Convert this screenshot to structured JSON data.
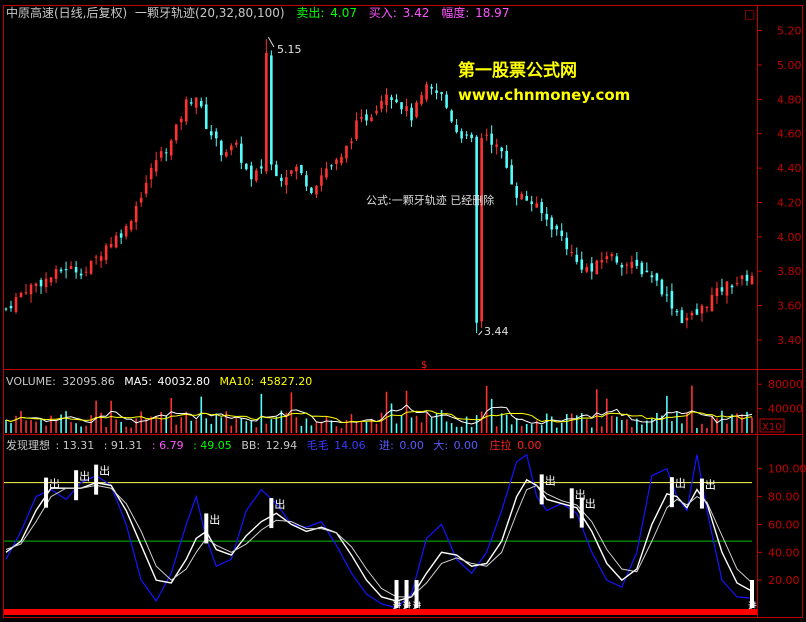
{
  "header": {
    "stock": "中原高速(日线,后复权)",
    "indicator": "一颗牙轨迹(20,32,80,100)",
    "sell_label": "卖出:",
    "sell_value": "4.07",
    "buy_label": "买入:",
    "buy_value": "3.42",
    "range_label": "幅度:",
    "range_value": "18.97"
  },
  "watermark": {
    "name": "第一股票公式网",
    "url": "www.chnmoney.com"
  },
  "annotations": {
    "high_label": "5.15",
    "low_label": "3.44",
    "formula_note": "公式:一颗牙轨迹 已经删除",
    "dollar_marker": "$",
    "corner_box": "□"
  },
  "volume_header": {
    "label": "VOLUME:",
    "volume": "32095.86",
    "ma5_label": "MA5:",
    "ma5": "40032.80",
    "ma10_label": "MA10:",
    "ma10": "45827.20",
    "multiplier": "X10"
  },
  "indicator_header": {
    "name": "发现理想",
    "v1": ": 13.31",
    "v2": ": 91.31",
    "v3": ": 6.79",
    "v4": ": 49.05",
    "bb_label": "BB:",
    "bb": "12.94",
    "fuzzy_label": "毛毛",
    "fuzzy": "14.06",
    "in_label": "进:",
    "in_value": "0.00",
    "big_label": "大:",
    "big_value": "0.00",
    "zhuang_label": "庄拉",
    "zhuang_value": "0.00"
  },
  "signal_labels": {
    "out": "出",
    "in": "进"
  },
  "colors": {
    "background": "#000000",
    "up_candle": "#ff3232",
    "down_candle": "#54fcfc",
    "axis": "#c00000",
    "header_sell": "#00ff00",
    "header_buy": "#ff54ff",
    "watermark": "#ffff00",
    "ma5": "#ffffff",
    "ma10": "#ffff00",
    "osc_fast": "#1414ff",
    "osc_mid": "#ffffff",
    "osc_slow": "#d0d0d0",
    "line_top": "#ffff54",
    "line_mid": "#00c000",
    "zhuang_bar": "#ff0000"
  },
  "chart_data": [
    {
      "type": "candlestick",
      "title": "中原高速(日线,后复权)",
      "y_ticks": [
        "5.20",
        "5.00",
        "4.80",
        "4.60",
        "4.40",
        "4.20",
        "4.00",
        "3.80",
        "3.60",
        "3.40"
      ],
      "ylim": [
        3.33,
        5.25
      ],
      "x_count": 150,
      "close_path": [
        [
          0,
          3.58
        ],
        [
          4,
          3.7
        ],
        [
          8,
          3.75
        ],
        [
          12,
          3.82
        ],
        [
          16,
          3.8
        ],
        [
          20,
          3.95
        ],
        [
          24,
          4.05
        ],
        [
          27,
          4.25
        ],
        [
          30,
          4.45
        ],
        [
          33,
          4.55
        ],
        [
          36,
          4.78
        ],
        [
          38,
          4.82
        ],
        [
          40,
          4.65
        ],
        [
          43,
          4.5
        ],
        [
          46,
          4.52
        ],
        [
          49,
          4.32
        ],
        [
          52,
          4.45
        ],
        [
          55,
          4.35
        ],
        [
          58,
          4.4
        ],
        [
          61,
          4.28
        ],
        [
          64,
          4.4
        ],
        [
          67,
          4.45
        ],
        [
          70,
          4.65
        ],
        [
          73,
          4.72
        ],
        [
          76,
          4.85
        ],
        [
          78,
          4.8
        ],
        [
          81,
          4.7
        ],
        [
          84,
          4.86
        ],
        [
          87,
          4.82
        ],
        [
          90,
          4.62
        ],
        [
          93,
          4.55
        ],
        [
          96,
          4.6
        ],
        [
          99,
          4.48
        ],
        [
          102,
          4.25
        ],
        [
          105,
          4.2
        ],
        [
          108,
          4.1
        ],
        [
          111,
          4.0
        ],
        [
          114,
          3.85
        ],
        [
          117,
          3.8
        ],
        [
          120,
          3.9
        ],
        [
          123,
          3.85
        ],
        [
          126,
          3.82
        ],
        [
          129,
          3.78
        ],
        [
          132,
          3.65
        ],
        [
          135,
          3.52
        ],
        [
          138,
          3.55
        ],
        [
          141,
          3.65
        ],
        [
          144,
          3.72
        ],
        [
          147,
          3.75
        ],
        [
          149,
          3.78
        ]
      ],
      "high": {
        "value": 5.15,
        "index": 52
      },
      "low": {
        "value": 3.44,
        "index": 94
      }
    },
    {
      "type": "bar",
      "title": "VOLUME",
      "y_ticks": [
        "80000",
        "40000"
      ],
      "ylim": [
        0,
        100000
      ],
      "series": [
        {
          "name": "VOLUME",
          "last": 32095.86
        },
        {
          "name": "MA5",
          "last": 40032.8
        },
        {
          "name": "MA10",
          "last": 45827.2
        }
      ]
    },
    {
      "type": "line",
      "title": "发现理想",
      "y_ticks": [
        "100.00",
        "80.00",
        "60.00",
        "40.00",
        "20.00"
      ],
      "ylim": [
        0,
        112
      ],
      "reference_lines": [
        90,
        48
      ],
      "series": [
        {
          "name": "fast",
          "points": [
            [
              0,
              35
            ],
            [
              3,
              55
            ],
            [
              6,
              80
            ],
            [
              9,
              85
            ],
            [
              12,
              78
            ],
            [
              15,
              90
            ],
            [
              18,
              95
            ],
            [
              21,
              88
            ],
            [
              24,
              60
            ],
            [
              27,
              20
            ],
            [
              30,
              5
            ],
            [
              33,
              25
            ],
            [
              36,
              60
            ],
            [
              38,
              80
            ],
            [
              40,
              50
            ],
            [
              42,
              30
            ],
            [
              45,
              35
            ],
            [
              48,
              70
            ],
            [
              51,
              85
            ],
            [
              54,
              75
            ],
            [
              57,
              60
            ],
            [
              60,
              58
            ],
            [
              63,
              62
            ],
            [
              66,
              45
            ],
            [
              69,
              25
            ],
            [
              72,
              10
            ],
            [
              75,
              3
            ],
            [
              78,
              0
            ],
            [
              81,
              10
            ],
            [
              84,
              50
            ],
            [
              87,
              60
            ],
            [
              90,
              35
            ],
            [
              93,
              25
            ],
            [
              96,
              40
            ],
            [
              99,
              70
            ],
            [
              102,
              105
            ],
            [
              104,
              110
            ],
            [
              106,
              80
            ],
            [
              108,
              70
            ],
            [
              111,
              75
            ],
            [
              114,
              68
            ],
            [
              117,
              40
            ],
            [
              120,
              20
            ],
            [
              123,
              15
            ],
            [
              126,
              40
            ],
            [
              129,
              95
            ],
            [
              132,
              100
            ],
            [
              134,
              80
            ],
            [
              136,
              70
            ],
            [
              138,
              110
            ],
            [
              140,
              70
            ],
            [
              143,
              20
            ],
            [
              146,
              8
            ],
            [
              149,
              7
            ]
          ]
        },
        {
          "name": "mid",
          "points": [
            [
              0,
              40
            ],
            [
              3,
              48
            ],
            [
              6,
              70
            ],
            [
              9,
              86
            ],
            [
              12,
              86
            ],
            [
              15,
              86
            ],
            [
              18,
              90
            ],
            [
              21,
              88
            ],
            [
              24,
              70
            ],
            [
              27,
              45
            ],
            [
              30,
              20
            ],
            [
              33,
              18
            ],
            [
              36,
              35
            ],
            [
              38,
              50
            ],
            [
              40,
              55
            ],
            [
              42,
              42
            ],
            [
              45,
              38
            ],
            [
              48,
              52
            ],
            [
              51,
              62
            ],
            [
              54,
              68
            ],
            [
              57,
              60
            ],
            [
              60,
              55
            ],
            [
              63,
              58
            ],
            [
              66,
              54
            ],
            [
              69,
              38
            ],
            [
              72,
              20
            ],
            [
              75,
              8
            ],
            [
              78,
              5
            ],
            [
              81,
              8
            ],
            [
              84,
              25
            ],
            [
              87,
              40
            ],
            [
              90,
              38
            ],
            [
              93,
              30
            ],
            [
              96,
              32
            ],
            [
              99,
              48
            ],
            [
              102,
              80
            ],
            [
              104,
              92
            ],
            [
              106,
              88
            ],
            [
              108,
              78
            ],
            [
              111,
              75
            ],
            [
              114,
              72
            ],
            [
              117,
              55
            ],
            [
              120,
              32
            ],
            [
              123,
              20
            ],
            [
              126,
              28
            ],
            [
              129,
              60
            ],
            [
              132,
              82
            ],
            [
              134,
              80
            ],
            [
              136,
              72
            ],
            [
              138,
              85
            ],
            [
              140,
              75
            ],
            [
              143,
              40
            ],
            [
              146,
              18
            ],
            [
              149,
              12
            ]
          ]
        },
        {
          "name": "slow",
          "points": [
            [
              0,
              42
            ],
            [
              3,
              46
            ],
            [
              6,
              62
            ],
            [
              9,
              80
            ],
            [
              12,
              86
            ],
            [
              15,
              86
            ],
            [
              18,
              88
            ],
            [
              21,
              86
            ],
            [
              24,
              75
            ],
            [
              27,
              55
            ],
            [
              30,
              30
            ],
            [
              33,
              20
            ],
            [
              36,
              28
            ],
            [
              38,
              40
            ],
            [
              40,
              50
            ],
            [
              42,
              45
            ],
            [
              45,
              40
            ],
            [
              48,
              46
            ],
            [
              51,
              56
            ],
            [
              54,
              63
            ],
            [
              57,
              62
            ],
            [
              60,
              57
            ],
            [
              63,
              57
            ],
            [
              66,
              54
            ],
            [
              69,
              44
            ],
            [
              72,
              28
            ],
            [
              75,
              14
            ],
            [
              78,
              8
            ],
            [
              81,
              8
            ],
            [
              84,
              18
            ],
            [
              87,
              32
            ],
            [
              90,
              36
            ],
            [
              93,
              32
            ],
            [
              96,
              30
            ],
            [
              99,
              40
            ],
            [
              102,
              68
            ],
            [
              104,
              85
            ],
            [
              106,
              88
            ],
            [
              108,
              82
            ],
            [
              111,
              77
            ],
            [
              114,
              74
            ],
            [
              117,
              62
            ],
            [
              120,
              42
            ],
            [
              123,
              28
            ],
            [
              126,
              26
            ],
            [
              129,
              48
            ],
            [
              132,
              72
            ],
            [
              134,
              78
            ],
            [
              136,
              74
            ],
            [
              138,
              80
            ],
            [
              140,
              76
            ],
            [
              143,
              52
            ],
            [
              146,
              28
            ],
            [
              149,
              18
            ]
          ]
        }
      ],
      "signals_out": [
        8,
        14,
        18,
        40,
        53,
        107,
        113,
        115,
        133,
        139
      ],
      "signals_in": [
        78,
        80,
        82,
        149
      ]
    }
  ]
}
